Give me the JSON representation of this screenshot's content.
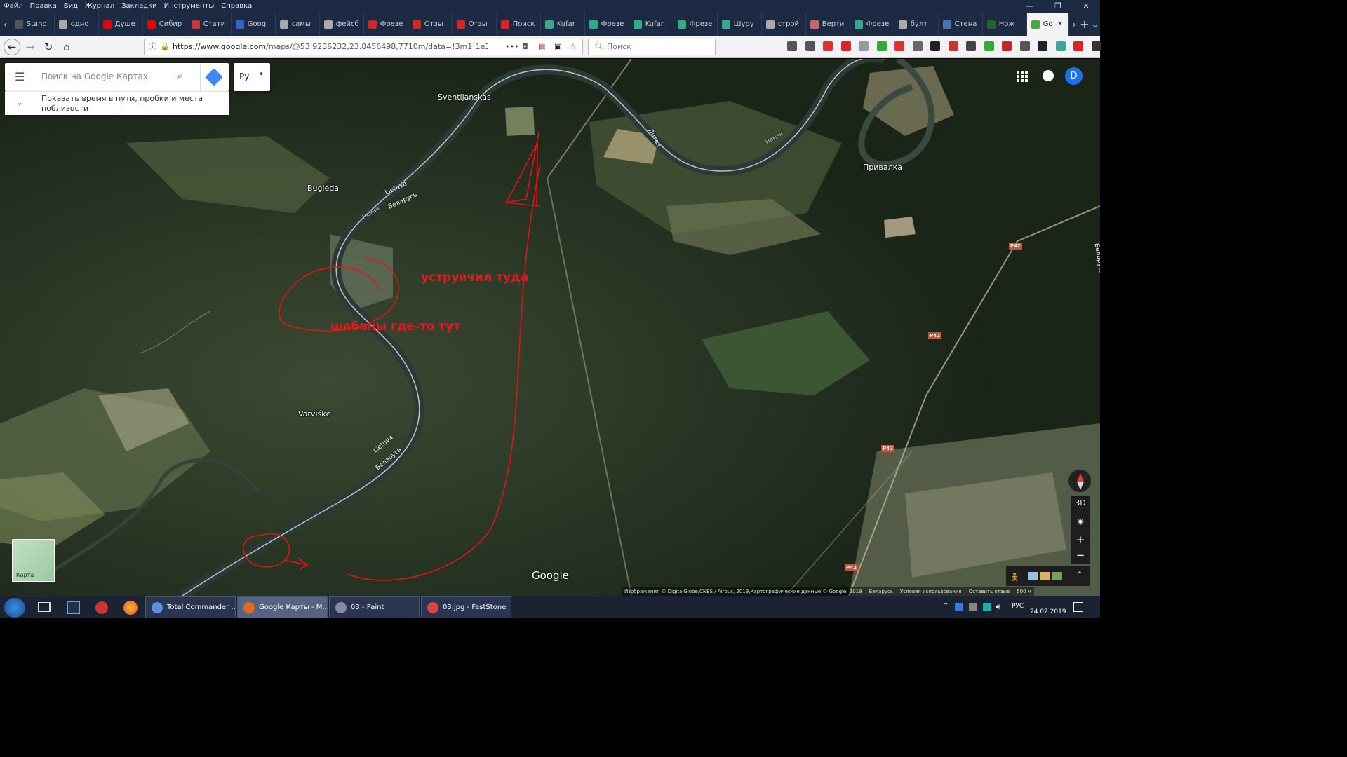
{
  "menu": [
    "Файл",
    "Правка",
    "Вид",
    "Журнал",
    "Закладки",
    "Инструменты",
    "Справка"
  ],
  "window_controls": [
    "—",
    "❐",
    "✕"
  ],
  "tabs": [
    {
      "label": "Stand",
      "color": "#555"
    },
    {
      "label": "одно",
      "color": "#aaa"
    },
    {
      "label": "Душе",
      "color": "#e00"
    },
    {
      "label": "Сибир",
      "color": "#e00"
    },
    {
      "label": "Стати",
      "color": "#c33"
    },
    {
      "label": "Googl",
      "color": "#36c"
    },
    {
      "label": "самы",
      "color": "#aaa"
    },
    {
      "label": "фейсб",
      "color": "#aaa"
    },
    {
      "label": "Фрезе",
      "color": "#d22"
    },
    {
      "label": "Отзы",
      "color": "#d22"
    },
    {
      "label": "Отзы",
      "color": "#d22"
    },
    {
      "label": "Поиск",
      "color": "#d22"
    },
    {
      "label": "Kufar",
      "color": "#3a8"
    },
    {
      "label": "Фрезе",
      "color": "#3a8"
    },
    {
      "label": "Kufar",
      "color": "#3a8"
    },
    {
      "label": "Фрезе",
      "color": "#3a8"
    },
    {
      "label": "Шуру",
      "color": "#3a8"
    },
    {
      "label": "строй",
      "color": "#aaa"
    },
    {
      "label": "Верти",
      "color": "#c66"
    },
    {
      "label": "Фрезе",
      "color": "#3a8"
    },
    {
      "label": "булт",
      "color": "#aaa"
    },
    {
      "label": "Стена",
      "color": "#47a"
    },
    {
      "label": "Нож",
      "color": "#262"
    },
    {
      "label": "Go",
      "color": "#4a4"
    }
  ],
  "url": {
    "domain": "https://www.google.com",
    "path": "/maps/@53.9236232,23.8456498,7710m/data=!3m1!1e3!5m1!"
  },
  "browser_search_placeholder": "Поиск",
  "maps": {
    "search_placeholder": "Поиск на Google Картах",
    "language": "Ру",
    "travel_toggle_text": "Показать время в пути, пробки и места поблизости",
    "avatar_letter": "D",
    "logo": "Google",
    "thumbnail_label": "Карта",
    "scale": "500 м",
    "footer": [
      "Изображения © DigitalGlobe,CNES / Airbus, 2019,Картографические данные © Google, 2019",
      "Беларусь",
      "Условия использования",
      "Оставить отзыв"
    ],
    "controls": {
      "tilt": "3D",
      "zoom_in": "+",
      "zoom_out": "−"
    }
  },
  "places": [
    "Sventijanskas",
    "Bugieda",
    "Varviškė",
    "Привалка"
  ],
  "borders": {
    "lt": "Lietuva",
    "by": "Беларусь",
    "lt_ru": "Литва",
    "river": "Неман",
    "by_edge": "Беларусь"
  },
  "roads": [
    "P42",
    "P42",
    "P42",
    "P42"
  ],
  "annotations": {
    "top": "уструячил туда",
    "middle": "шабаны где-то тут"
  },
  "taskbar": [
    {
      "label": "Total Commander ...",
      "color": "#5b8fd8"
    },
    {
      "label": "Google Карты - M...",
      "color": "#e6681f"
    },
    {
      "label": "03 - Paint",
      "color": "#88a"
    },
    {
      "label": "03.jpg - FastStone",
      "color": "#d44"
    }
  ],
  "tray": {
    "lang": "РУС",
    "date": "24.02.2019"
  }
}
